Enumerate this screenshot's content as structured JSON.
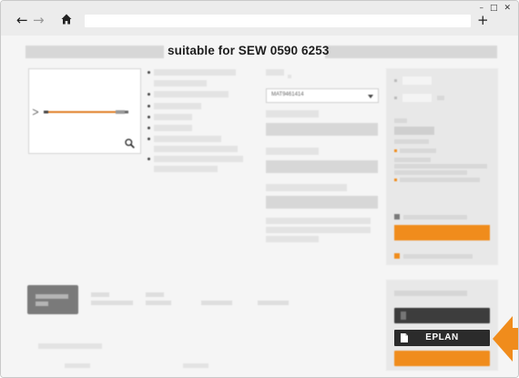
{
  "browser": {
    "back_icon": "arrow-left-icon",
    "forward_icon": "arrow-right-icon",
    "home_icon": "home-icon",
    "new_tab_icon": "plus-icon",
    "window_controls": [
      "–",
      "□",
      "✕"
    ]
  },
  "product": {
    "title": "suitable for SEW 0590 6253",
    "material_select_value": "MAT9461414"
  },
  "downloads": {
    "eplan_label": "EPLAN",
    "eplan_icon": "document-icon"
  },
  "colors": {
    "accent": "#f08c1c",
    "button_dark": "#2b2b2b",
    "panel": "#e8e8e8"
  }
}
